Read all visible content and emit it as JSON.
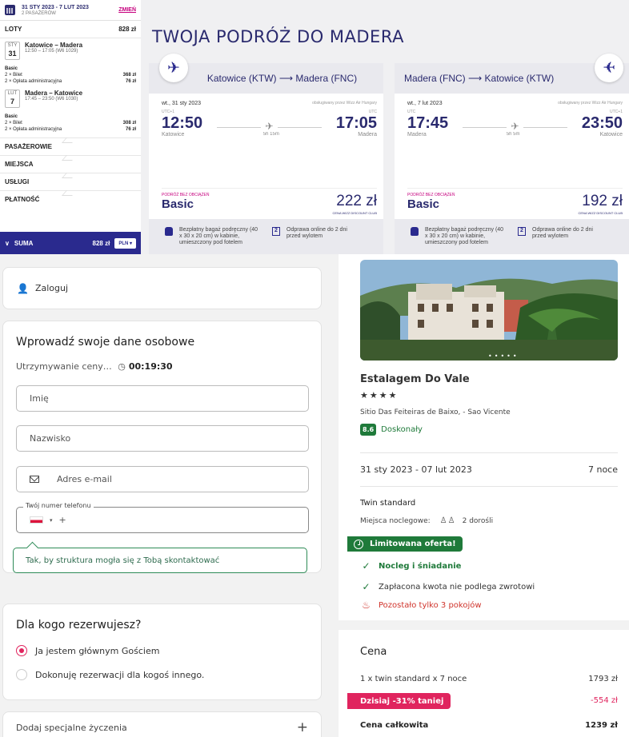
{
  "wizz": {
    "summary": {
      "dates": "31 STY 2023 - 7 LUT 2023",
      "passengers": "2 PASAŻERÓW",
      "change": "ZMIEŃ",
      "flights_label": "LOTY",
      "flights_total": "828 zł",
      "flights": [
        {
          "month": "STY",
          "day": "31",
          "route": "Katowice – Madera",
          "time": "12:50 – 17:05 (W6 1029)",
          "fare": "Basic",
          "line1": "2 × Bilet",
          "price1": "368 zł",
          "line2": "2 × Opłata administracyjna",
          "price2": "76 zł"
        },
        {
          "month": "LUT",
          "day": "7",
          "route": "Madera – Katowice",
          "time": "17:45 – 23:50 (W6 1030)",
          "fare": "Basic",
          "line1": "2 × Bilet",
          "price1": "308 zł",
          "line2": "2 × Opłata administracyjna",
          "price2": "76 zł"
        }
      ],
      "sections": [
        "PASAŻEROWIE",
        "MIEJSCA",
        "USŁUGI",
        "PŁATNOŚĆ"
      ],
      "sum_label": "SUMA",
      "sum_value": "828 zł",
      "currency": "PLN"
    },
    "title": "TWOJA PODRÓŻ DO MADERA",
    "cards": [
      {
        "header": "Katowice (KTW) ⟶ Madera (FNC)",
        "date": "wt., 31 sty 2023",
        "operator": "obsługiwany przez Wizz Air Hungary",
        "dep_tz": "UTC+1",
        "arr_tz": "UTC",
        "dep_time": "12:50",
        "arr_time": "17:05",
        "dep_city": "Katowice",
        "arr_city": "Madera",
        "duration": "5h 15m",
        "fare_label": "PODRÓŻ BEZ OBCIĄŻEŃ",
        "fare_name": "Basic",
        "price": "222 zł",
        "club": "CENA WIZZ DISCOUNT CLUB",
        "perk1": "Bezpłatny bagaż podręczny (40 x 30 x 20 cm) w kabinie, umieszczony pod fotelem",
        "perk2": "Odprawa online do 2 dni przed wylotem"
      },
      {
        "header": "Madera (FNC) ⟶ Katowice (KTW)",
        "date": "wt., 7 lut 2023",
        "operator": "obsługiwany przez Wizz Air Hungary",
        "dep_tz": "UTC",
        "arr_tz": "UTC+1",
        "dep_time": "17:45",
        "arr_time": "23:50",
        "dep_city": "Madera",
        "arr_city": "Katowice",
        "duration": "5h 5m",
        "fare_label": "PODRÓŻ BEZ OBCIĄŻEŃ",
        "fare_name": "Basic",
        "price": "192 zł",
        "club": "CENA WIZZ DISCOUNT CLUB",
        "perk1": "Bezpłatny bagaż podręczny (40 x 30 x 20 cm) w kabinie, umieszczony pod fotelem",
        "perk2": "Odprawa online do 2 dni przed wylotem"
      }
    ],
    "box_icon_number": "2",
    "colors": {
      "brand": "#2a2a6e",
      "accent": "#c6007e"
    }
  },
  "form": {
    "login": "Zaloguj",
    "personal_title": "Wprowadź swoje dane osobowe",
    "hold_label": "Utrzymywanie ceny…",
    "hold_time": "00:19:30",
    "first_name_ph": "Imię",
    "last_name_ph": "Nazwisko",
    "email_ph": "Adres e-mail",
    "phone_label": "Twój numer telefonu",
    "phone_prefix": "+",
    "tip": "Tak, by struktura mogła się z Tobą skontaktować",
    "booking_for_title": "Dla kogo rezerwujesz?",
    "option_me": "Ja jestem głównym Gościem",
    "option_other": "Dokonuję rezerwacji dla kogoś innego.",
    "special_requests": "Dodaj specjalne życzenia"
  },
  "hotel": {
    "name": "Estalagem Do Vale",
    "stars": "★★★★",
    "address": "Sitio Das Feiteiras de Baixo, - Sao Vicente",
    "score": "8.6",
    "score_label": "Doskonały",
    "dates": "31 sty 2023 - 07 lut 2023",
    "nights": "7 noce",
    "room": "Twin standard",
    "beds_label": "Miejsca noclegowe:",
    "guests": "2 dorośli",
    "offer": "Limitowana oferta!",
    "features": [
      "Nocleg i śniadanie",
      "Zapłacona kwota nie podlega zwrotowi"
    ],
    "scarcity": "Pozostało tylko 3 pokojów",
    "price_title": "Cena",
    "line_label": "1 x twin standard x 7 noce",
    "line_price": "1793 zł",
    "discount_label": "Dzisiaj -31% taniej",
    "discount_value": "-554 zł",
    "total_label": "Cena całkowita",
    "total_value": "1239 zł",
    "colors": {
      "green": "#1f7a3a",
      "pink": "#e0245e"
    }
  }
}
